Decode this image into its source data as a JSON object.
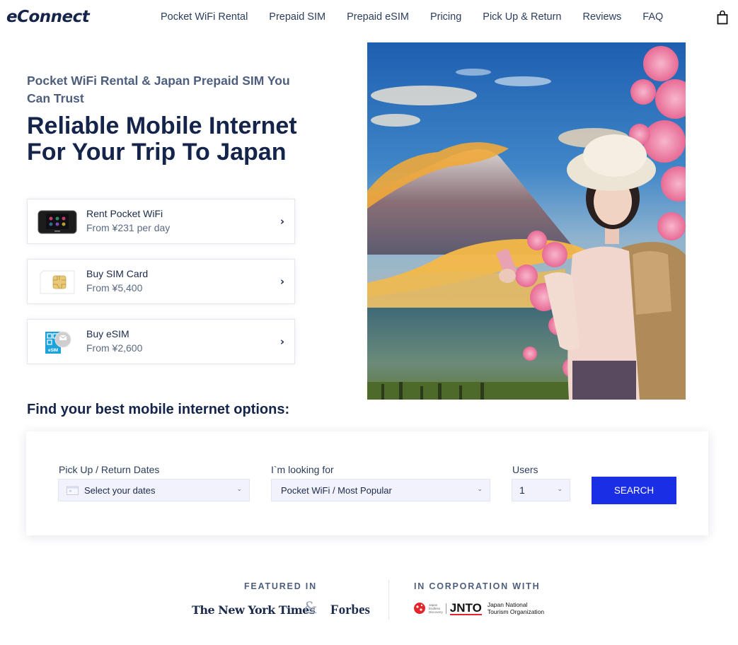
{
  "header": {
    "logo": "eConnect",
    "nav": [
      {
        "label": "Pocket WiFi Rental"
      },
      {
        "label": "Prepaid SIM"
      },
      {
        "label": "Prepaid eSIM"
      },
      {
        "label": "Pricing"
      },
      {
        "label": "Pick Up & Return"
      },
      {
        "label": "Reviews"
      },
      {
        "label": "FAQ"
      }
    ],
    "cart_icon": "shopping-bag-icon"
  },
  "hero": {
    "eyebrow": "Pocket WiFi Rental & Japan Prepaid SIM You Can Trust",
    "headline_line1": "Reliable Mobile Internet",
    "headline_line2": "For Your Trip To Japan",
    "image_alt": "Woman in hat holding phone in front of Mt. Fuji and cherry blossoms",
    "products": [
      {
        "title": "Rent Pocket WiFi",
        "price": "From ¥231 per day",
        "icon": "pocket-wifi-device"
      },
      {
        "title": "Buy SIM Card",
        "price": "From ¥5,400",
        "icon": "sim-card"
      },
      {
        "title": "Buy eSIM",
        "price": "From ¥2,600",
        "icon": "esim-qr"
      }
    ],
    "chevron": "›"
  },
  "search": {
    "title": "Find your best mobile internet options:",
    "dates_label": "Pick Up / Return Dates",
    "dates_value": "Select your dates",
    "looking_label": "I`m looking for",
    "looking_value": "Pocket WiFi / Most Popular",
    "users_label": "Users",
    "users_value": "1",
    "caret": "⌄",
    "button": "SEARCH",
    "button_color": "#1a2ee6"
  },
  "featured": {
    "label": "FEATURED IN",
    "nyt": "The New York Times",
    "amp": "&",
    "forbes": "Forbes"
  },
  "corporation": {
    "label": "IN CORPORATION WITH",
    "jed_line1": "Japan",
    "jed_line2": "Endless",
    "jed_line3": "Discovery",
    "jnto": "JNTO",
    "jnto_line1": "Japan National",
    "jnto_line2": "Tourism Organization"
  }
}
